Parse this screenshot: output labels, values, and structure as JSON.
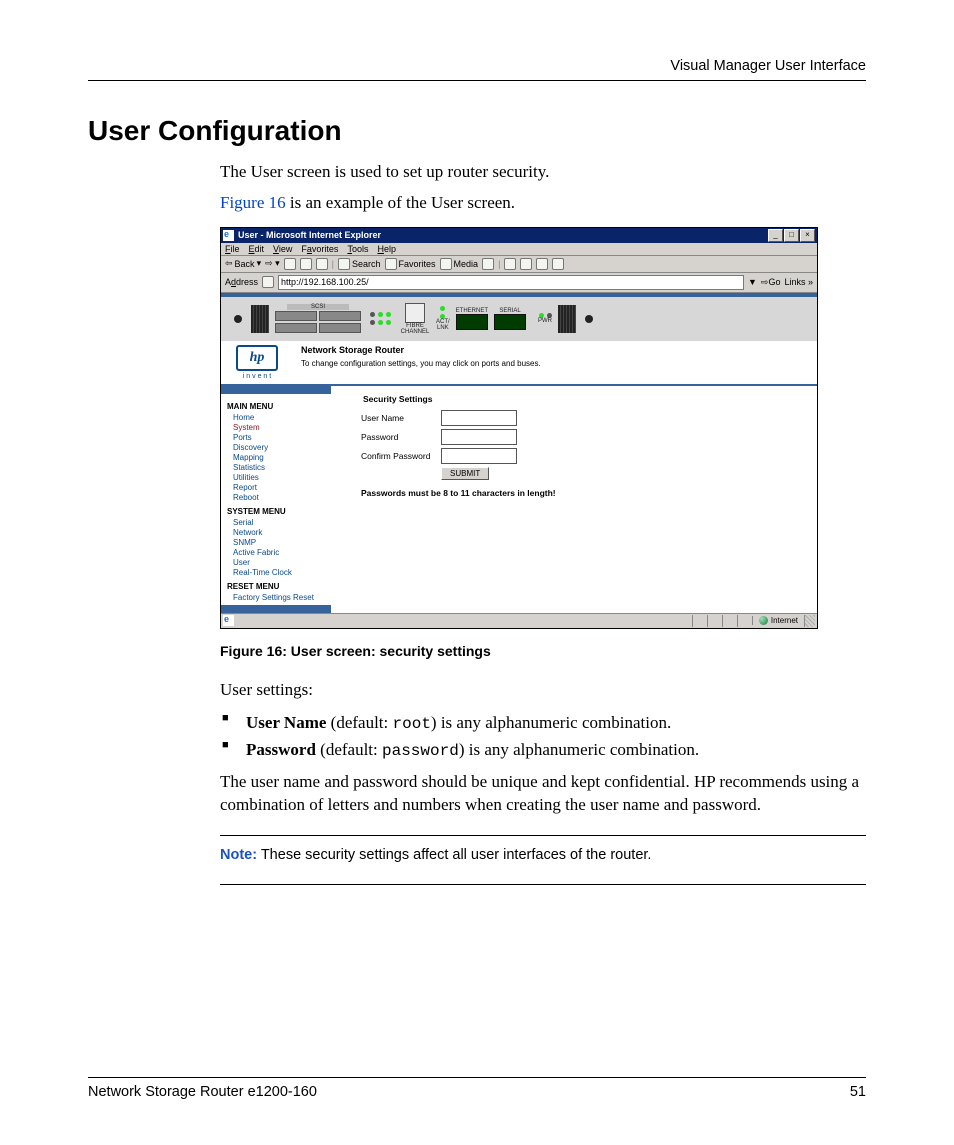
{
  "header": {
    "right": "Visual Manager User Interface"
  },
  "section_title": "User Configuration",
  "intro1": "The User screen is used to set up router security.",
  "intro2_a": "Figure 16",
  "intro2_b": " is an example of the User screen.",
  "ie": {
    "title": "User - Microsoft Internet Explorer",
    "menus": {
      "file": "File",
      "edit": "Edit",
      "view": "View",
      "favorites": "Favorites",
      "tools": "Tools",
      "help": "Help"
    },
    "toolbar": {
      "back": "Back",
      "search": "Search",
      "favorites": "Favorites",
      "media": "Media"
    },
    "address_label": "Address",
    "address_value": "http://192.168.100.25/",
    "go": "Go",
    "links": "Links",
    "router_title": "Network Storage Router",
    "router_sub": "To change configuration settings, you may click on ports and buses.",
    "hp_invent": "i n v e n t",
    "device": {
      "scsi": "SCSI",
      "fibre": "FIBRE CHANNEL",
      "actlnk": "ACT/\nLNK",
      "ethernet": "ETHERNET",
      "serial": "SERIAL",
      "pwr": "PWR"
    },
    "menu": {
      "main_head": "MAIN MENU",
      "main": [
        "Home",
        "System",
        "Ports",
        "Discovery",
        "Mapping",
        "Statistics",
        "Utilities",
        "Report",
        "Reboot"
      ],
      "sys_head": "SYSTEM MENU",
      "sys": [
        "Serial",
        "Network",
        "SNMP",
        "Active Fabric",
        "User",
        "Real-Time Clock"
      ],
      "reset_head": "RESET MENU",
      "reset": [
        "Factory Settings Reset"
      ]
    },
    "form": {
      "head": "Security Settings",
      "user": "User Name",
      "pass": "Password",
      "confirm": "Confirm Password",
      "submit": "SUBMIT",
      "rule": "Passwords must be 8 to 11 characters in length!"
    },
    "status": {
      "zone": "Internet"
    }
  },
  "figure_caption": "Figure 16:  User screen: security settings",
  "post1": "User settings:",
  "bullet1_a": "User Name",
  "bullet1_pre": " (default: ",
  "bullet1_code": "root",
  "bullet1_post": ") is any alphanumeric combination.",
  "bullet2_a": "Password",
  "bullet2_pre": " (default: ",
  "bullet2_code": "password",
  "bullet2_post": ") is any alphanumeric combination.",
  "post2": "The user name and password should be unique and kept confidential. HP recommends using a combination of letters and numbers when creating the user name and password.",
  "note_lead": "Note:",
  "note_body": "  These security settings affect all user interfaces of the router.",
  "footer_left": "Network Storage Router e1200-160",
  "footer_right": "51"
}
